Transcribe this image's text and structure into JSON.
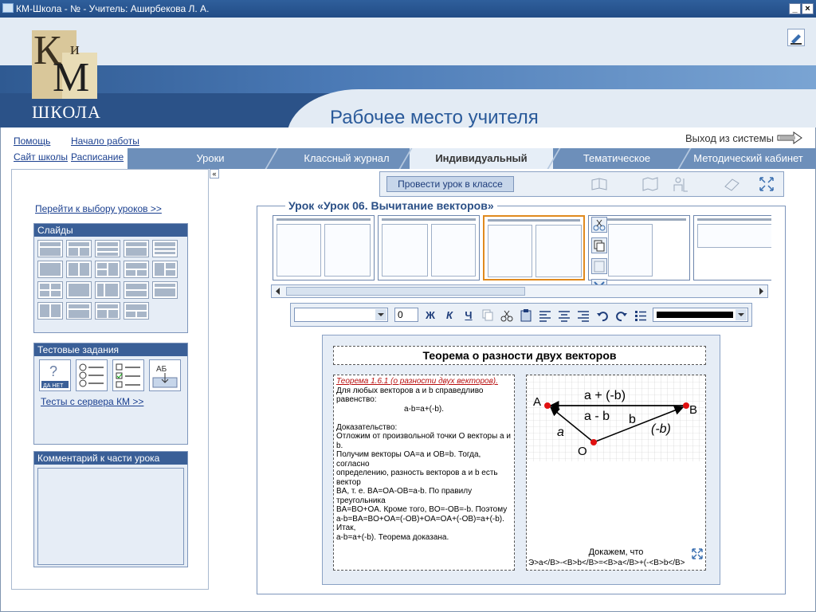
{
  "window": {
    "title": "КМ-Школа -  №  - Учитель: Аширбекова Л. А."
  },
  "header": {
    "logo": {
      "k": "К",
      "i": "и",
      "m": "М",
      "school": "ШКОЛА"
    },
    "app_title": "Рабочее место учителя",
    "logout": "Выход из системы"
  },
  "top_links": {
    "help": "Помощь",
    "start": "Начало работы",
    "school_site": "Сайт школы",
    "schedule": "Расписание"
  },
  "tabs": [
    {
      "label": "Уроки"
    },
    {
      "label": "Классный журнал"
    },
    {
      "label": "Индивидуальный портфель",
      "active": true
    },
    {
      "label": "Тематическое планирование"
    },
    {
      "label": "Методический кабинет"
    }
  ],
  "left": {
    "goto_lessons": "Перейти к выбору уроков >>",
    "slides_header": "Слайды",
    "tests_header": "Тестовые задания",
    "tests_link": "Тесты с сервера КМ >>",
    "comment_header": "Комментарий к части урока",
    "test_icons": [
      "yes-no-test-icon",
      "numbered-list-test-icon",
      "checklist-test-icon",
      "text-input-test-icon"
    ],
    "test_button_text": {
      "yes_no": "ДА НЕТ",
      "input": "АБ"
    }
  },
  "toolbar1": {
    "conduct_label": "Провести урок в классе"
  },
  "lesson": {
    "title": "Урок «Урок 06. Вычитание векторов»"
  },
  "editor_toolbar": {
    "font_size": "0",
    "bold": "Ж",
    "italic": "К",
    "underline": "Ч"
  },
  "slide": {
    "title": "Теорема о разности двух векторов",
    "theorem_head": "Теорема 1.6.1 (о разности двух векторов).",
    "lines": [
      "Для любых векторов a и b справедливо",
      "равенство:",
      "a-b=a+(-b).",
      "",
      "Доказательство:",
      "Отложим от произвольной точки O векторы a и b.",
      "Получим векторы OA=a и OB=b. Тогда, согласно",
      "определению, разность векторов a и b есть вектор",
      "BA, т. е. BA=OA-OB=a-b. По правилу треугольника",
      "BA=BO+OA. Кроме того, BO=-OB=-b. Поэтому",
      "a-b=BA=BO+OA=(-OB)+OA=OA+(-OB)=a+(-b). Итак,",
      "a-b=a+(-b). Теорема доказана."
    ],
    "figure": {
      "label_a_plus": "a + (-b)",
      "label_a_minus": "a - b",
      "label_b": "b",
      "label_neg_b": "(-b)",
      "label_a": "a",
      "point_A": "A",
      "point_B": "B",
      "point_O": "O"
    },
    "caption": "Докажем, что",
    "formula": "Э>a</B>-<B>b</B>=<B>a</B>+(-<B>b</B>"
  }
}
